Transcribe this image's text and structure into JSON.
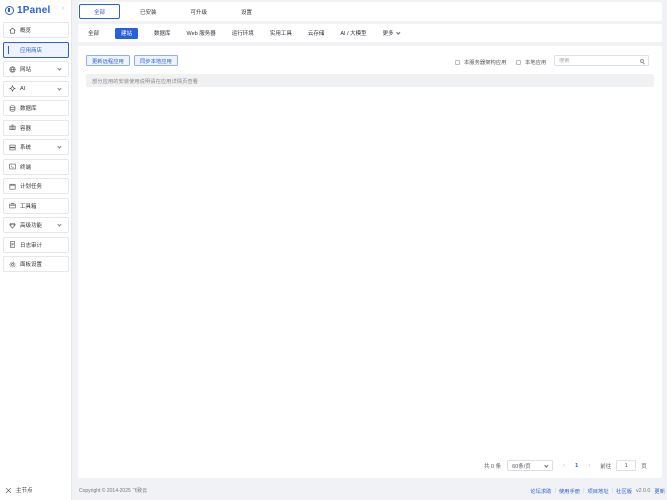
{
  "app": {
    "logo_text": "1Panel"
  },
  "sidebar": {
    "items": [
      {
        "label": "概览",
        "icon": "home-icon"
      },
      {
        "label": "应用商店",
        "icon": "store-icon",
        "active": true
      },
      {
        "label": "网站",
        "icon": "globe-icon",
        "expandable": true
      },
      {
        "label": "AI",
        "icon": "ai-icon",
        "expandable": true
      },
      {
        "label": "数据库",
        "icon": "database-icon"
      },
      {
        "label": "容器",
        "icon": "container-icon"
      },
      {
        "label": "系统",
        "icon": "system-icon",
        "expandable": true
      },
      {
        "label": "终端",
        "icon": "terminal-icon"
      },
      {
        "label": "计划任务",
        "icon": "calendar-icon"
      },
      {
        "label": "工具箱",
        "icon": "toolbox-icon"
      },
      {
        "label": "高级功能",
        "icon": "diamond-icon",
        "expandable": true
      },
      {
        "label": "日志审计",
        "icon": "log-icon"
      },
      {
        "label": "面板设置",
        "icon": "settings-icon"
      }
    ],
    "node_label": "主节点"
  },
  "top_tabs": [
    {
      "label": "全部",
      "active": true
    },
    {
      "label": "已安装"
    },
    {
      "label": "可升级"
    },
    {
      "label": "设置"
    }
  ],
  "categories": [
    {
      "label": "全部"
    },
    {
      "label": "建站",
      "active": true
    },
    {
      "label": "数据库"
    },
    {
      "label": "Web 服务器"
    },
    {
      "label": "运行环境"
    },
    {
      "label": "实用工具"
    },
    {
      "label": "云存储"
    },
    {
      "label": "AI / 大模型"
    },
    {
      "label": "更多",
      "dropdown": true
    }
  ],
  "toolbar": {
    "sync_remote_label": "更新远程应用",
    "sync_local_label": "同步本地应用",
    "server_arch_label": "本服务器架构应用",
    "local_app_label": "本地应用",
    "search_placeholder": "搜索"
  },
  "notice": "部分应用的安装使用说明请在应用详情页查看",
  "pagination": {
    "total_text": "共 0 条",
    "page_size": "60条/页",
    "prev": "‹",
    "current_page": "1",
    "next": "›",
    "goto_label": "前往",
    "goto_value": "1",
    "page_unit": "页"
  },
  "footer": {
    "copyright": "Copyright © 2014-2025 飞致云",
    "links": [
      "论坛求助",
      "使用手册",
      "项目地址",
      "社区版"
    ],
    "version": "v2.0.0",
    "update_label": "更新"
  },
  "colors": {
    "accent": "#2b5fd9",
    "bg": "#f0f2f5"
  }
}
